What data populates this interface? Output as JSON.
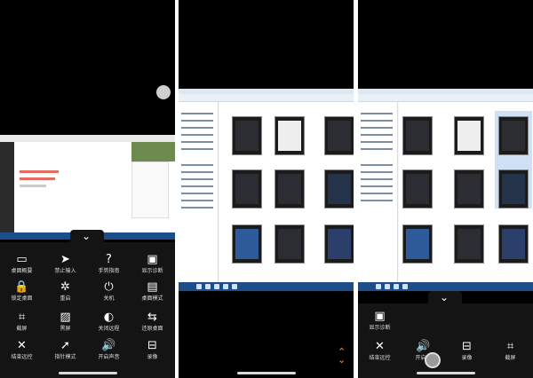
{
  "panel1": {
    "menu_items": [
      {
        "icon": "desktop-overview-icon",
        "glyph": "▭",
        "label": "桌面概要"
      },
      {
        "icon": "cursor-icon",
        "glyph": "➤",
        "label": "禁止输入"
      },
      {
        "icon": "help-icon",
        "glyph": "?",
        "label": "手势指南"
      },
      {
        "icon": "display-diag-icon",
        "glyph": "▣",
        "label": "显示诊断"
      },
      {
        "icon": "lock-icon",
        "glyph": "🔒",
        "label": "锁定桌面"
      },
      {
        "icon": "reboot-icon",
        "glyph": "✲",
        "label": "重启"
      },
      {
        "icon": "power-icon",
        "glyph": "⏻",
        "label": "关机"
      },
      {
        "icon": "desktop-mode-icon",
        "glyph": "▤",
        "label": "桌面模式"
      },
      {
        "icon": "crop-icon",
        "glyph": "⌗",
        "label": "截屏"
      },
      {
        "icon": "black-screen-icon",
        "glyph": "▨",
        "label": "黑屏"
      },
      {
        "icon": "remote-mouse-icon",
        "glyph": "◐",
        "label": "关闭远程"
      },
      {
        "icon": "switch-desktop-icon",
        "glyph": "⇆",
        "label": "还原桌面"
      },
      {
        "icon": "close-icon",
        "glyph": "✕",
        "label": "结束远控"
      },
      {
        "icon": "pointer-icon",
        "glyph": "➚",
        "label": "指针模式"
      },
      {
        "icon": "sound-icon",
        "glyph": "🔊",
        "label": "开启声音"
      },
      {
        "icon": "record-icon",
        "glyph": "⊟",
        "label": "录像"
      }
    ]
  },
  "panel3": {
    "top_item": {
      "icon": "display-diag-icon",
      "glyph": "▣",
      "label": "显示诊断"
    },
    "menu_items": [
      {
        "icon": "close-icon",
        "glyph": "✕",
        "label": "结束远控"
      },
      {
        "icon": "sound-icon",
        "glyph": "🔊",
        "label": "开启声"
      },
      {
        "icon": "record-icon",
        "glyph": "⊟",
        "label": "录像"
      },
      {
        "icon": "crop-icon",
        "glyph": "⌗",
        "label": "截屏"
      }
    ]
  },
  "colors": {
    "menu_bg": "#141414",
    "accent": "#f29a2e",
    "taskbar": "#1d4e89"
  }
}
